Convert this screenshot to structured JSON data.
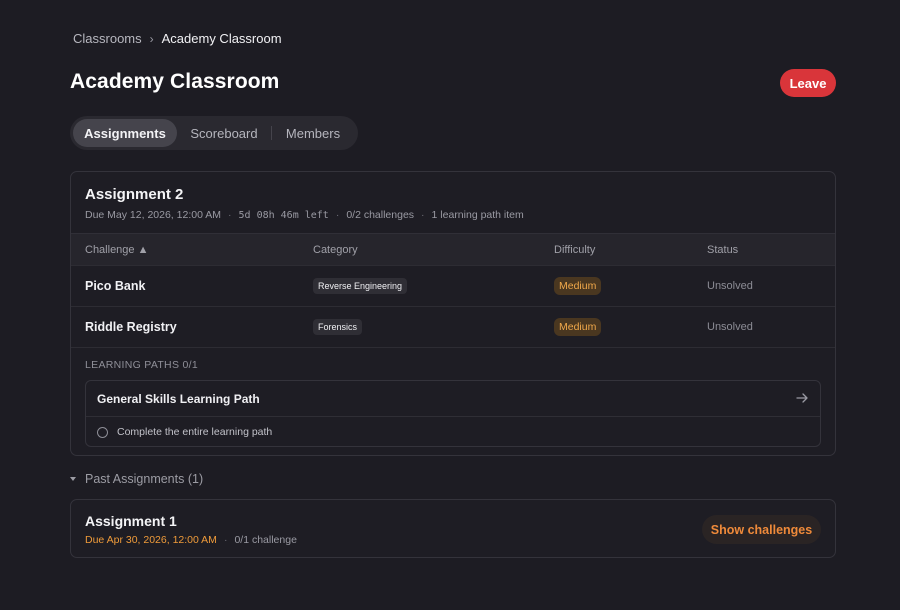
{
  "breadcrumb": {
    "parent": "Classrooms",
    "separator": "›",
    "current": "Academy Classroom"
  },
  "header": {
    "title": "Academy Classroom",
    "leave_label": "Leave",
    "leave_color": "#d9353a"
  },
  "tabs": [
    {
      "label": "Assignments",
      "active": true
    },
    {
      "label": "Scoreboard",
      "active": false
    },
    {
      "label": "Members",
      "active": false
    }
  ],
  "assignment": {
    "title": "Assignment 2",
    "due": "Due May 12, 2026, 12:00 AM",
    "time_left": "5d 08h 46m left",
    "challenges": "0/2 challenges",
    "learning_items": "1 learning path item",
    "columns": {
      "challenge": "Challenge ▲",
      "category": "Category",
      "difficulty": "Difficulty",
      "status": "Status"
    },
    "rows": [
      {
        "name": "Pico Bank",
        "category": "Reverse Engineering",
        "difficulty": "Medium",
        "status": "Unsolved"
      },
      {
        "name": "Riddle Registry",
        "category": "Forensics",
        "difficulty": "Medium",
        "status": "Unsolved"
      }
    ],
    "learning_paths": {
      "label": "LEARNING PATHS 0/1",
      "path_title": "General Skills Learning Path",
      "item": "Complete the entire learning path"
    }
  },
  "past": {
    "toggle_label": "Past Assignments (1)",
    "title": "Assignment 1",
    "due": "Due Apr 30, 2026, 12:00 AM",
    "challenges": "0/1 challenge",
    "show_label": "Show challenges"
  },
  "colors": {
    "accent_orange": "#ef8a3a",
    "difficulty_medium": "#f0a84a",
    "background": "#1d1c23"
  },
  "icons": {
    "breadcrumb_sep": "chevron-right-icon",
    "lp_arrow": "arrow-right-icon",
    "lp_item": "circle-icon",
    "past_toggle": "caret-down-icon"
  }
}
